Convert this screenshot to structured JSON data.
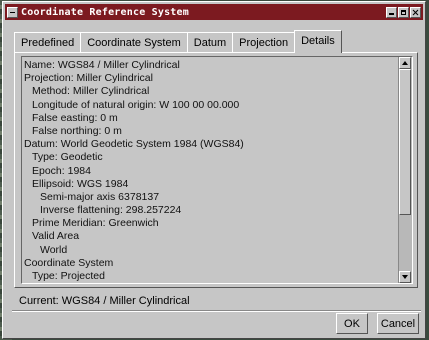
{
  "window": {
    "title": "Coordinate Reference System",
    "title_bar_color": "#7c1a20"
  },
  "tabs": [
    {
      "label": "Predefined",
      "active": false
    },
    {
      "label": "Coordinate System",
      "active": false
    },
    {
      "label": "Datum",
      "active": false
    },
    {
      "label": "Projection",
      "active": false
    },
    {
      "label": "Details",
      "active": true
    }
  ],
  "details": {
    "lines": [
      "Name: WGS84 / Miller Cylindrical",
      "Projection: Miller Cylindrical",
      "  Method: Miller Cylindrical",
      "  Longitude of natural origin: W 100 00 00.000",
      "  False easting: 0 m",
      "  False northing: 0 m",
      "Datum: World Geodetic System 1984 (WGS84)",
      "  Type: Geodetic",
      "  Epoch: 1984",
      "  Ellipsoid: WGS 1984",
      "    Semi-major axis 6378137",
      "    Inverse flattening: 298.257224",
      "  Prime Meridian: Greenwich",
      "  Valid Area",
      "    World",
      "Coordinate System",
      "  Type: Projected"
    ]
  },
  "status": {
    "current": "Current: WGS84 / Miller Cylindrical"
  },
  "buttons": {
    "ok": "OK",
    "cancel": "Cancel"
  }
}
